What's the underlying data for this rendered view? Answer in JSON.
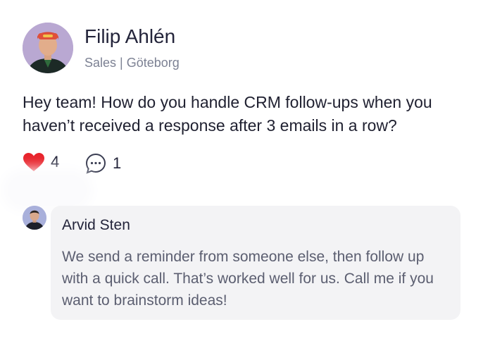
{
  "post": {
    "author": {
      "name": "Filip Ahlén",
      "meta": "Sales | Göteborg"
    },
    "text": "Hey team! How do you handle CRM follow-ups when you haven’t received a response after 3 emails in a row?",
    "likes": "4",
    "comments": "1"
  },
  "reply": {
    "author": "Arvid Sten",
    "text": "We send a reminder from someone else, then follow up with a quick call. That’s worked well for us. Call me if you want to brainstorm ideas!"
  },
  "colors": {
    "heart": "#e8232b",
    "bubble": "#f3f3f5",
    "meta_text": "#7c8193"
  },
  "icons": {
    "like": "heart-icon",
    "comment": "comment-bubble-icon"
  }
}
